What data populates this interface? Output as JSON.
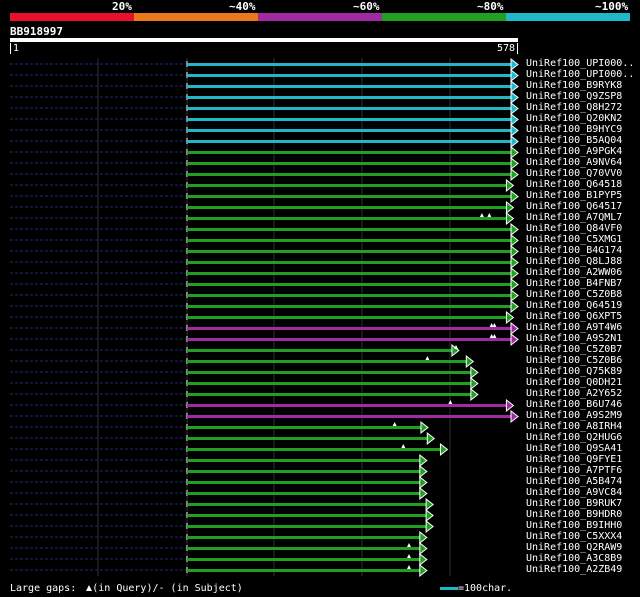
{
  "colors": {
    "background": "#000000",
    "c20": "#e8102a",
    "c40": "#e87818",
    "c60": "#a02aa0",
    "c80": "#20a020",
    "c100": "#20b8c8",
    "query_bar": "#ffffff",
    "dash": "#1a2a7a",
    "grid": "#303030"
  },
  "scale": {
    "labels": [
      "20%",
      "~40%",
      "~60%",
      "~80%",
      "~100%"
    ]
  },
  "query": {
    "id": "BB918997",
    "start": "1",
    "end": "578"
  },
  "footer": {
    "gaps_label": "Large gaps:",
    "in_query": "(in Query)",
    "in_subject": "/- (in Subject)",
    "legend": "=100char."
  },
  "chart_data": {
    "type": "alignment",
    "query_length": 578,
    "hits": [
      {
        "name": "UniRef100_UPI000..",
        "start": 1,
        "end": 578,
        "identity": "100",
        "query_gaps": []
      },
      {
        "name": "UniRef100_UPI000..",
        "start": 1,
        "end": 578,
        "identity": "100",
        "query_gaps": []
      },
      {
        "name": "UniRef100_B9RYK8",
        "start": 1,
        "end": 578,
        "identity": "100",
        "query_gaps": []
      },
      {
        "name": "UniRef100_Q9ZSP8",
        "start": 1,
        "end": 578,
        "identity": "100",
        "query_gaps": []
      },
      {
        "name": "UniRef100_Q8H272",
        "start": 1,
        "end": 578,
        "identity": "100",
        "query_gaps": []
      },
      {
        "name": "UniRef100_Q20KN2",
        "start": 1,
        "end": 578,
        "identity": "100",
        "query_gaps": []
      },
      {
        "name": "UniRef100_B9HYC9",
        "start": 1,
        "end": 578,
        "identity": "100",
        "query_gaps": []
      },
      {
        "name": "UniRef100_B5AQ04",
        "start": 1,
        "end": 578,
        "identity": "100",
        "query_gaps": []
      },
      {
        "name": "UniRef100_A9PGK4",
        "start": 1,
        "end": 578,
        "identity": "80",
        "query_gaps": []
      },
      {
        "name": "UniRef100_A9NV64",
        "start": 1,
        "end": 578,
        "identity": "80",
        "query_gaps": []
      },
      {
        "name": "UniRef100_Q70VV0",
        "start": 1,
        "end": 578,
        "identity": "80",
        "query_gaps": []
      },
      {
        "name": "UniRef100_Q64518",
        "start": 1,
        "end": 570,
        "identity": "80",
        "query_gaps": []
      },
      {
        "name": "UniRef100_B1PYP5",
        "start": 1,
        "end": 578,
        "identity": "80",
        "query_gaps": []
      },
      {
        "name": "UniRef100_Q64517",
        "start": 1,
        "end": 570,
        "identity": "80",
        "query_gaps": []
      },
      {
        "name": "UniRef100_A7QML7",
        "start": 1,
        "end": 570,
        "identity": "80",
        "query_gaps": [
          515,
          528
        ]
      },
      {
        "name": "UniRef100_Q84VF0",
        "start": 1,
        "end": 578,
        "identity": "80",
        "query_gaps": []
      },
      {
        "name": "UniRef100_C5XMG1",
        "start": 1,
        "end": 578,
        "identity": "80",
        "query_gaps": []
      },
      {
        "name": "UniRef100_B4G174",
        "start": 1,
        "end": 578,
        "identity": "80",
        "query_gaps": []
      },
      {
        "name": "UniRef100_Q8LJ88",
        "start": 1,
        "end": 578,
        "identity": "80",
        "query_gaps": []
      },
      {
        "name": "UniRef100_A2WW06",
        "start": 1,
        "end": 578,
        "identity": "80",
        "query_gaps": []
      },
      {
        "name": "UniRef100_B4FNB7",
        "start": 1,
        "end": 578,
        "identity": "80",
        "query_gaps": []
      },
      {
        "name": "UniRef100_C5Z0B8",
        "start": 1,
        "end": 578,
        "identity": "80",
        "query_gaps": []
      },
      {
        "name": "UniRef100_Q64519",
        "start": 1,
        "end": 578,
        "identity": "80",
        "query_gaps": []
      },
      {
        "name": "UniRef100_Q6XPT5",
        "start": 1,
        "end": 570,
        "identity": "80",
        "query_gaps": []
      },
      {
        "name": "UniRef100_A9T4W6",
        "start": 1,
        "end": 578,
        "identity": "60",
        "query_gaps": [
          532,
          537
        ]
      },
      {
        "name": "UniRef100_A9S2N1",
        "start": 1,
        "end": 578,
        "identity": "60",
        "query_gaps": [
          532,
          537
        ]
      },
      {
        "name": "UniRef100_C5Z0B7",
        "start": 1,
        "end": 475,
        "identity": "80",
        "query_gaps": [
          470
        ]
      },
      {
        "name": "UniRef100_C5Z0B6",
        "start": 1,
        "end": 500,
        "identity": "80",
        "query_gaps": [
          420
        ]
      },
      {
        "name": "UniRef100_Q75K89",
        "start": 1,
        "end": 508,
        "identity": "80",
        "query_gaps": []
      },
      {
        "name": "UniRef100_Q0DH21",
        "start": 1,
        "end": 508,
        "identity": "80",
        "query_gaps": []
      },
      {
        "name": "UniRef100_A2Y652",
        "start": 1,
        "end": 508,
        "identity": "80",
        "query_gaps": []
      },
      {
        "name": "UniRef100_B6U746",
        "start": 1,
        "end": 570,
        "identity": "60",
        "query_gaps": [
          460
        ]
      },
      {
        "name": "UniRef100_A9S2M9",
        "start": 1,
        "end": 578,
        "identity": "60",
        "query_gaps": []
      },
      {
        "name": "UniRef100_A8IRH4",
        "start": 1,
        "end": 421,
        "identity": "80",
        "query_gaps": [
          363
        ]
      },
      {
        "name": "UniRef100_Q2HUG6",
        "start": 1,
        "end": 432,
        "identity": "80",
        "query_gaps": []
      },
      {
        "name": "UniRef100_Q9SA41",
        "start": 1,
        "end": 455,
        "identity": "80",
        "query_gaps": [
          378
        ]
      },
      {
        "name": "UniRef100_Q9FYE1",
        "start": 1,
        "end": 419,
        "identity": "80",
        "query_gaps": []
      },
      {
        "name": "UniRef100_A7PTF6",
        "start": 1,
        "end": 419,
        "identity": "80",
        "query_gaps": []
      },
      {
        "name": "UniRef100_A5B474",
        "start": 1,
        "end": 419,
        "identity": "80",
        "query_gaps": []
      },
      {
        "name": "UniRef100_A9VC84",
        "start": 1,
        "end": 419,
        "identity": "80",
        "query_gaps": []
      },
      {
        "name": "UniRef100_B9RUK7",
        "start": 1,
        "end": 430,
        "identity": "80",
        "query_gaps": []
      },
      {
        "name": "UniRef100_B9HDR0",
        "start": 1,
        "end": 430,
        "identity": "80",
        "query_gaps": []
      },
      {
        "name": "UniRef100_B9IHH0",
        "start": 1,
        "end": 430,
        "identity": "80",
        "query_gaps": []
      },
      {
        "name": "UniRef100_C5XXX4",
        "start": 1,
        "end": 419,
        "identity": "80",
        "query_gaps": []
      },
      {
        "name": "UniRef100_Q2RAW9",
        "start": 1,
        "end": 419,
        "identity": "80",
        "query_gaps": [
          388
        ]
      },
      {
        "name": "UniRef100_A3C8B9",
        "start": 1,
        "end": 419,
        "identity": "80",
        "query_gaps": [
          388
        ]
      },
      {
        "name": "UniRef100_A2ZB49",
        "start": 1,
        "end": 419,
        "identity": "80",
        "query_gaps": [
          388
        ]
      }
    ]
  }
}
